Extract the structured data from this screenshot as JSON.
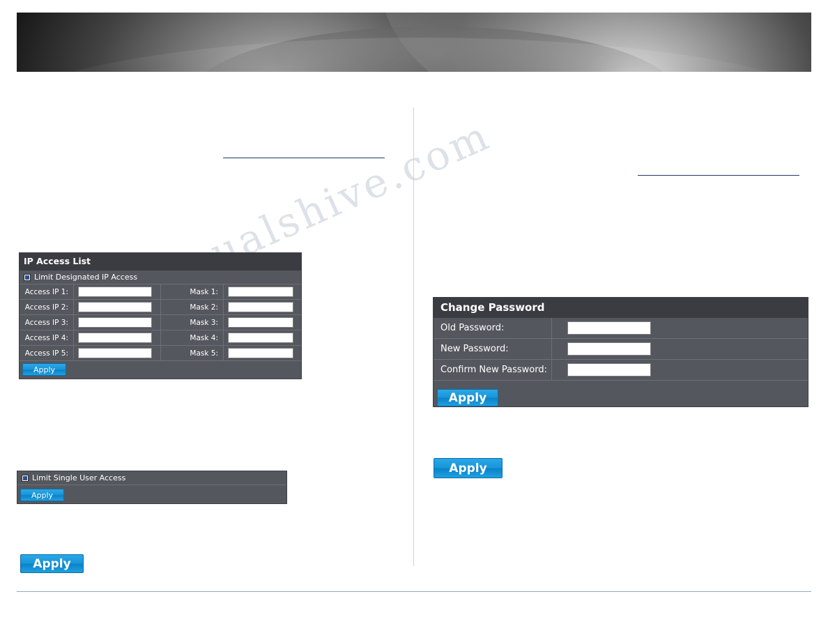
{
  "page": {
    "watermark_text": "manualshive.com"
  },
  "ip_access_list": {
    "title": "IP Access List",
    "limit_checkbox_label": "Limit Designated IP Access",
    "rows": [
      {
        "ip_label": "Access IP 1:",
        "ip_value": "",
        "mask_label": "Mask 1:",
        "mask_value": ""
      },
      {
        "ip_label": "Access IP 2:",
        "ip_value": "",
        "mask_label": "Mask 2:",
        "mask_value": ""
      },
      {
        "ip_label": "Access IP 3:",
        "ip_value": "",
        "mask_label": "Mask 3:",
        "mask_value": ""
      },
      {
        "ip_label": "Access IP 4:",
        "ip_value": "",
        "mask_label": "Mask 4:",
        "mask_value": ""
      },
      {
        "ip_label": "Access IP 5:",
        "ip_value": "",
        "mask_label": "Mask 5:",
        "mask_value": ""
      }
    ],
    "apply_label": "Apply"
  },
  "single_user": {
    "limit_checkbox_label": "Limit Single User Access",
    "apply_label": "Apply"
  },
  "left_big_button": {
    "apply_label": "Apply"
  },
  "change_password": {
    "title": "Change Password",
    "rows": [
      {
        "label": "Old Password:",
        "value": ""
      },
      {
        "label": "New Password:",
        "value": ""
      },
      {
        "label": "Confirm New Password:",
        "value": ""
      }
    ],
    "apply_label": "Apply"
  },
  "right_big_button": {
    "apply_label": "Apply"
  },
  "colors": {
    "panel_body": "#55575e",
    "panel_header": "#3b3c42",
    "accent_blue": "#1995d8",
    "rule_blue": "#1f3864",
    "divider": "#c9d4e2"
  }
}
